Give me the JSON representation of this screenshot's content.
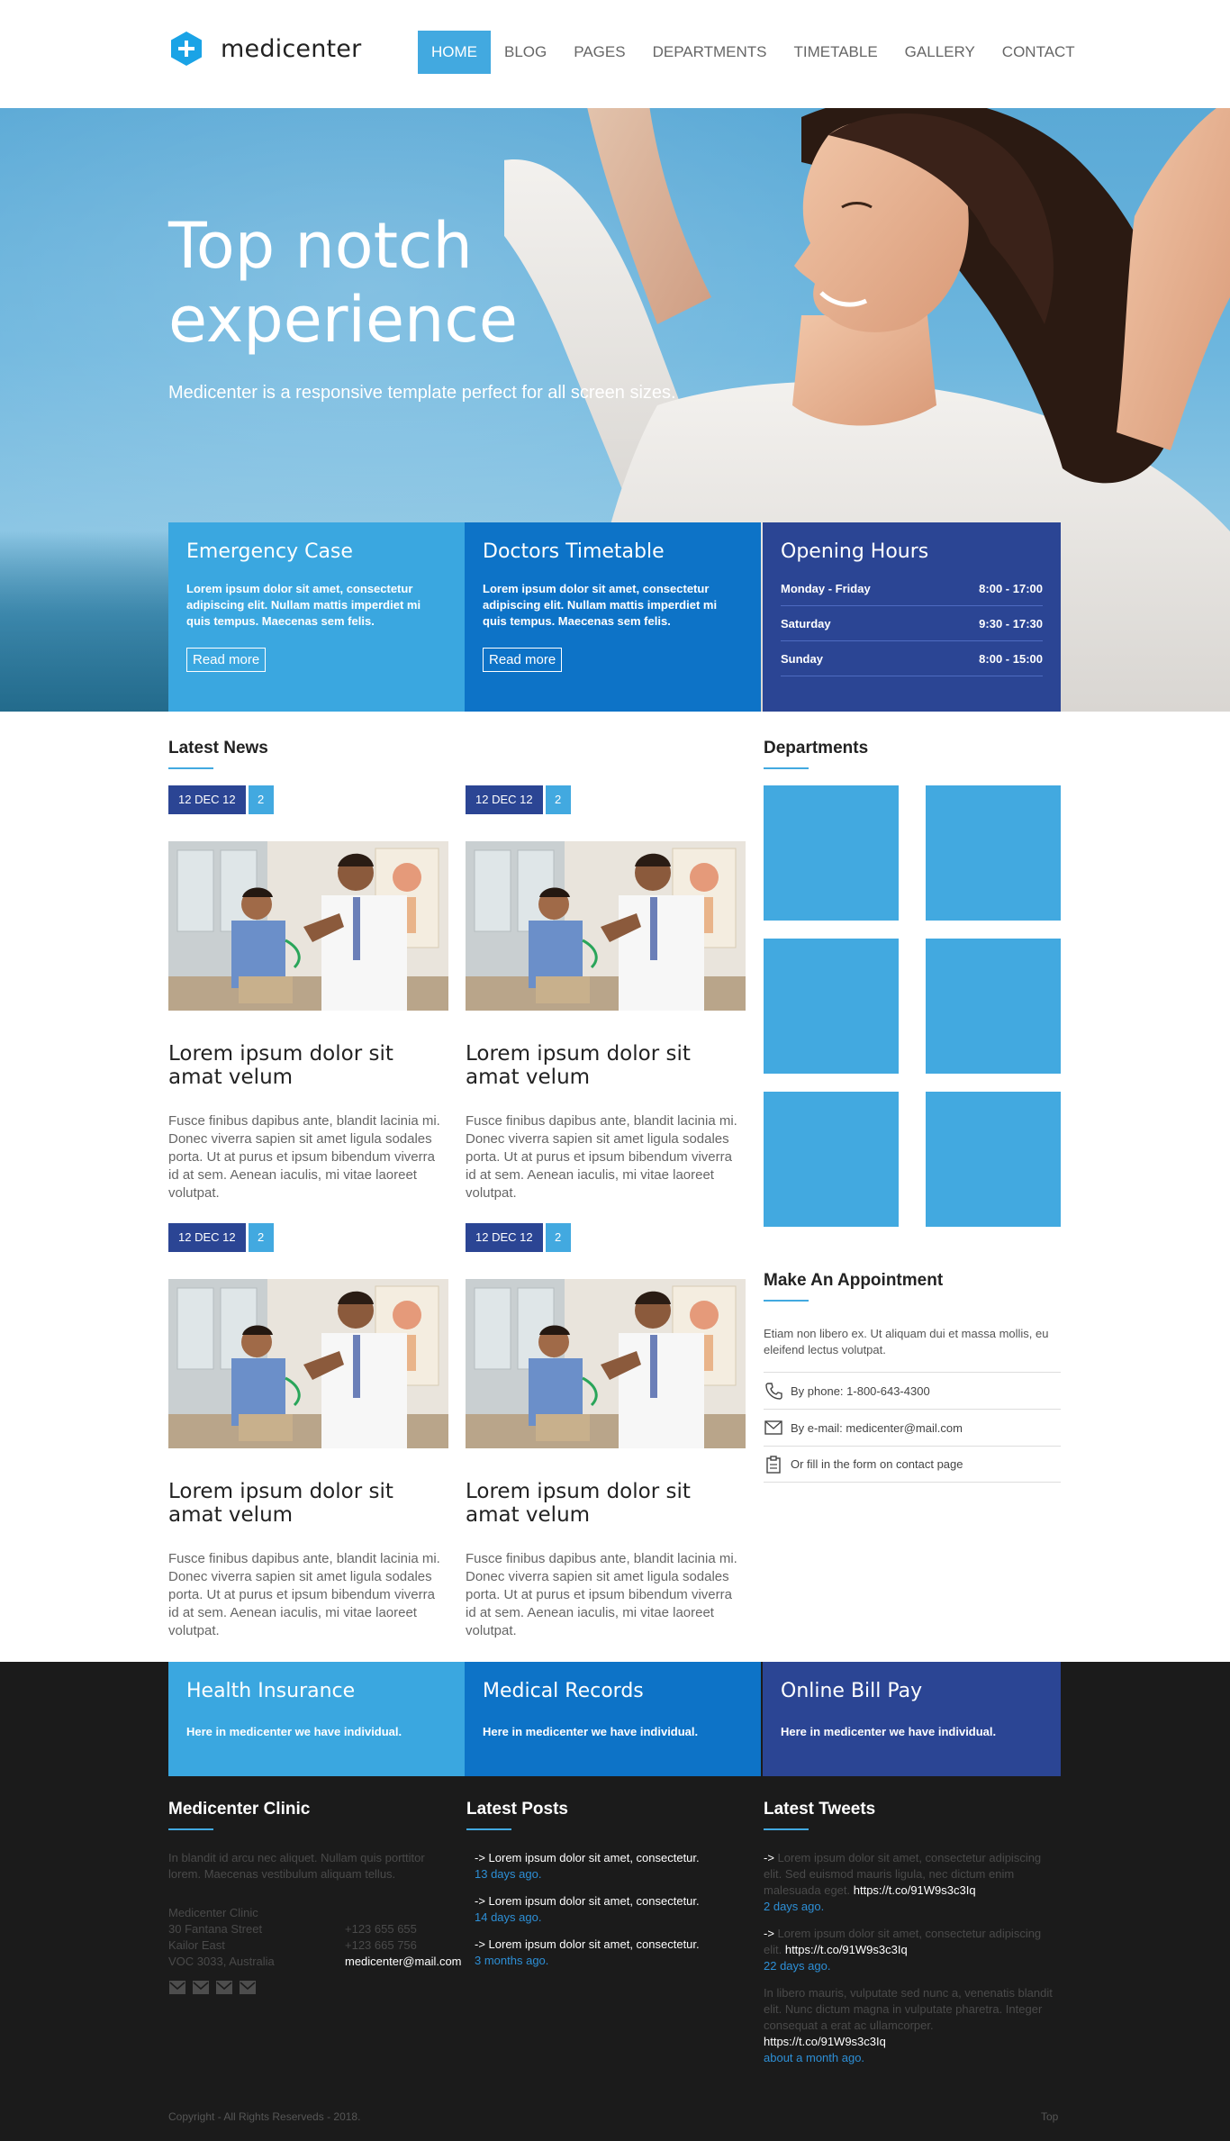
{
  "header": {
    "logo_text": "medicenter",
    "nav": [
      "HOME",
      "BLOG",
      "PAGES",
      "DEPARTMENTS",
      "TIMETABLE",
      "GALLERY",
      "CONTACT"
    ],
    "active_index": 0
  },
  "hero": {
    "title": "Top notch experience",
    "subtitle": "Medicenter is a responsive template perfect for all screen sizes."
  },
  "info_boxes": {
    "emergency": {
      "title": "Emergency Case",
      "text": "Lorem ipsum dolor sit amet, consectetur adipiscing elit. Nullam mattis imperdiet mi quis tempus. Maecenas sem felis.",
      "button": "Read more"
    },
    "timetable": {
      "title": "Doctors Timetable",
      "text": "Lorem ipsum dolor sit amet, consectetur adipiscing elit. Nullam mattis imperdiet mi quis tempus. Maecenas sem felis.",
      "button": "Read more"
    },
    "hours": {
      "title": "Opening Hours",
      "rows": [
        {
          "day": "Monday - Friday",
          "time": "8:00 - 17:00"
        },
        {
          "day": "Saturday",
          "time": "9:30 - 17:30"
        },
        {
          "day": "Sunday",
          "time": "8:00 - 15:00"
        }
      ]
    }
  },
  "latest_news": {
    "title": "Latest News",
    "posts": [
      {
        "date": "12 DEC 12",
        "comments": "2",
        "title": "Lorem ipsum dolor sit amat velum",
        "text": "Fusce finibus dapibus ante, blandit lacinia mi. Donec viverra sapien sit amet ligula sodales porta. Ut at purus et ipsum bibendum viverra id at sem. Aenean iaculis, mi vitae laoreet volutpat."
      },
      {
        "date": "12 DEC 12",
        "comments": "2",
        "title": "Lorem ipsum dolor sit amat velum",
        "text": "Fusce finibus dapibus ante, blandit lacinia mi. Donec viverra sapien sit amet ligula sodales porta. Ut at purus et ipsum bibendum viverra id at sem. Aenean iaculis, mi vitae laoreet volutpat."
      },
      {
        "date": "12 DEC 12",
        "comments": "2",
        "title": "Lorem ipsum dolor sit amat velum",
        "text": "Fusce finibus dapibus ante, blandit lacinia mi. Donec viverra sapien sit amet ligula sodales porta. Ut at purus et ipsum bibendum viverra id at sem. Aenean iaculis, mi vitae laoreet volutpat."
      },
      {
        "date": "12 DEC 12",
        "comments": "2",
        "title": "Lorem ipsum dolor sit amat velum",
        "text": "Fusce finibus dapibus ante, blandit lacinia mi. Donec viverra sapien sit amet ligula sodales porta. Ut at purus et ipsum bibendum viverra id at sem. Aenean iaculis, mi vitae laoreet volutpat."
      }
    ]
  },
  "departments": {
    "title": "Departments"
  },
  "appointment": {
    "title": "Make An Appointment",
    "text": "Etiam non libero ex. Ut aliquam dui et massa mollis, eu eleifend lectus volutpat.",
    "phone": "By phone: 1-800-643-4300",
    "email": "By e-mail: medicenter@mail.com",
    "form": "Or fill in the form on contact page"
  },
  "footer_boxes": [
    {
      "title": "Health Insurance",
      "text": "Here in medicenter we have individual."
    },
    {
      "title": "Medical Records",
      "text": "Here in medicenter we have individual."
    },
    {
      "title": "Online Bill Pay",
      "text": "Here in medicenter we have individual."
    }
  ],
  "clinic": {
    "title": "Medicenter Clinic",
    "intro": "In blandit id arcu nec aliquet. Nullam quis porttitor lorem. Maecenas vestibulum aliquam tellus.",
    "address": [
      "Medicenter Clinic",
      "30 Fantana Street",
      "Kailor East",
      "VOC 3033, Australia"
    ],
    "phones": [
      "+123 655 655",
      "+123 665 756"
    ],
    "email": "medicenter@mail.com"
  },
  "latest_posts": {
    "title": "Latest Posts",
    "items": [
      {
        "text": "-> Lorem ipsum dolor sit amet, consectetur.",
        "date": "13 days ago."
      },
      {
        "text": "-> Lorem ipsum dolor sit amet, consectetur.",
        "date": "14 days ago."
      },
      {
        "text": "-> Lorem ipsum dolor sit amet, consectetur.",
        "date": "3 months ago."
      }
    ]
  },
  "latest_tweets": {
    "title": "Latest Tweets",
    "items": [
      {
        "prefix": "->",
        "text": " Lorem ipsum dolor sit amet, consectetur adipiscing elit. Sed euismod mauris ligula, nec dictum enim malesuada eget. ",
        "link": "https://t.co/91W9s3c3Iq",
        "date": "2 days ago."
      },
      {
        "prefix": "->",
        "text": " Lorem ipsum dolor sit amet, consectetur adipiscing elit. ",
        "link": "https://t.co/91W9s3c3Iq",
        "date": "22 days ago."
      },
      {
        "prefix": "->",
        "text": " In libero mauris, vulputate sed nunc a, venenatis blandit elit. Nunc dictum magna in vulputate pharetra. Integer consequat a erat ac ullamcorper. ",
        "link": "https://t.co/91W9s3c3Iq",
        "date": "about a month ago."
      }
    ]
  },
  "copyright": "Copyright - All Rights Reserveds - 2018.",
  "top_link": "Top",
  "colors": {
    "accent": "#42a9e0",
    "mid_blue": "#0d73c7",
    "dark_blue": "#2b4594",
    "footer_bg": "#1b1b1b"
  }
}
